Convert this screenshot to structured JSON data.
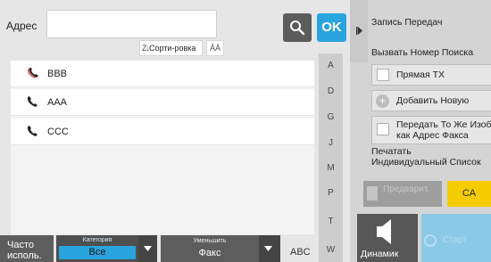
{
  "address": {
    "label": "Адрес",
    "value": "",
    "placeholder": ""
  },
  "search_icon": "search-icon",
  "ok_label": "OK",
  "sort": {
    "label": "Сорти-ровка",
    "text_size_icon": "text-size-icon"
  },
  "contacts": [
    {
      "name": "BBB",
      "icon": "group-handset-icon"
    },
    {
      "name": "AAA",
      "icon": "handset-icon"
    },
    {
      "name": "CCC",
      "icon": "handset-icon"
    }
  ],
  "alpha_index": [
    "A",
    "D",
    "G",
    "J",
    "M",
    "P",
    "T",
    "W"
  ],
  "bottom": {
    "frequent_line1": "Часто",
    "frequent_line2": "исполь.",
    "category_caption": "Категория",
    "category_value": "Все",
    "reduce_caption": "Уменьшить",
    "reduce_value": "Факс",
    "abc_label": "ABC"
  },
  "right_panel": {
    "record_label": "Запись Передач",
    "call_search_label": "Вызвать Номер Поиска",
    "direct_tx_label": "Прямая TX",
    "add_new_label": "Добавить Новую",
    "same_image_line1": "Передать То Же Изоб.",
    "same_image_line2": "как Адрес Факса",
    "print_line1": "Печатать",
    "print_line2": "Индивидуальный Список",
    "preview_label": "Предварит.",
    "ca_label": "CA",
    "speaker_label": "Динамик",
    "start_label": "Старт"
  },
  "colors": {
    "accent_blue": "#2aa4de",
    "ca_yellow": "#f4cc00",
    "start_disabled": "#8cc9e7"
  }
}
